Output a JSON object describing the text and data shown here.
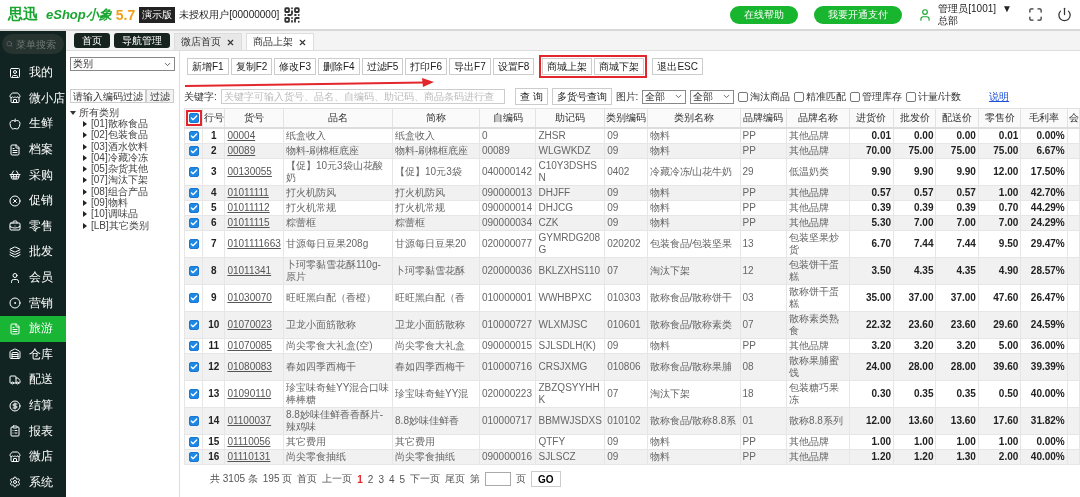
{
  "header": {
    "brand": "思迅",
    "product": "eShop小象",
    "version": "5.7",
    "edition": "演示版",
    "user_status": "未授权用户[00000000]",
    "buttons": [
      "在线帮助",
      "我要开通支付"
    ],
    "account": "管理员[1001]",
    "account_caret": "▼",
    "branch": "总部"
  },
  "nav": {
    "search_placeholder": "菜单搜索",
    "items": [
      {
        "label": "我的",
        "selected": false
      },
      {
        "label": "微小店",
        "selected": false
      },
      {
        "label": "生鲜",
        "selected": false
      },
      {
        "label": "档案",
        "selected": false
      },
      {
        "label": "采购",
        "selected": false
      },
      {
        "label": "促销",
        "selected": false
      },
      {
        "label": "零售",
        "selected": false
      },
      {
        "label": "批发",
        "selected": false
      },
      {
        "label": "会员",
        "selected": false
      },
      {
        "label": "营销",
        "selected": false
      },
      {
        "label": "旅游",
        "selected": true
      },
      {
        "label": "仓库",
        "selected": false
      },
      {
        "label": "配送",
        "selected": false
      },
      {
        "label": "结算",
        "selected": false
      },
      {
        "label": "报表",
        "selected": false
      },
      {
        "label": "微店",
        "selected": false
      },
      {
        "label": "系统",
        "selected": false
      }
    ]
  },
  "tabs": [
    {
      "label": "首页",
      "kind": "pinned",
      "selected": false
    },
    {
      "label": "导航管理",
      "kind": "pinned",
      "selected": false
    },
    {
      "label": "微店首页",
      "kind": "closable",
      "selected": false
    },
    {
      "label": "商品上架",
      "kind": "closable",
      "selected": true
    }
  ],
  "category_panel": {
    "type_select": "类别",
    "filter_placeholder": "请输入编码过滤",
    "filter_button": "过滤",
    "tree": [
      {
        "label": "所有类别",
        "expanded": true,
        "children": [
          {
            "label": "[01]散称食品",
            "expanded": false
          },
          {
            "label": "[02]包装食品",
            "expanded": false
          },
          {
            "label": "[03]酒水饮料",
            "expanded": false
          },
          {
            "label": "[04]冷藏冷冻",
            "expanded": false
          },
          {
            "label": "[05]杂货其他",
            "expanded": false
          },
          {
            "label": "[07]淘汰下架",
            "expanded": false
          },
          {
            "label": "[08]组合产品",
            "expanded": false
          },
          {
            "label": "[09]物料",
            "expanded": false
          },
          {
            "label": "[10]调味品",
            "expanded": false
          },
          {
            "label": "[LB]其它类别",
            "expanded": false
          }
        ]
      }
    ]
  },
  "toolbar": [
    {
      "highlighted": false,
      "buttons": [
        "新增F1",
        "复制F2",
        "修改F3",
        "删除F4",
        "过滤F5",
        "打印F6",
        "导出F7",
        "设置F8"
      ]
    },
    {
      "highlighted": true,
      "buttons": [
        "商城上架",
        "商城下架"
      ]
    },
    {
      "highlighted": false,
      "buttons": [
        "退出ESC"
      ]
    }
  ],
  "search": {
    "keyword_label": "关键字:",
    "keyword_placeholder": "关键字可输入货号、品名、自编码、助记码、商品条码进行查",
    "query_button": "查 询",
    "multi_button": "多货号查询",
    "picture_label": "图片:",
    "selects": [
      "全部",
      "全部"
    ],
    "options": [
      {
        "label": "淘汰商品",
        "checked": false
      },
      {
        "label": "精准匹配",
        "checked": false
      },
      {
        "label": "管理库存",
        "checked": false
      },
      {
        "label": "计量/计数",
        "checked": false
      }
    ],
    "help_link": "说明"
  },
  "table": {
    "select_all": {
      "checked": true,
      "highlighted": true
    },
    "columns": [
      {
        "label": "行号",
        "kind": "index"
      },
      {
        "label": "货号",
        "kind": "link"
      },
      {
        "label": "品名",
        "kind": "text"
      },
      {
        "label": "简称",
        "kind": "text"
      },
      {
        "label": "自编码",
        "kind": "text"
      },
      {
        "label": "助记码",
        "kind": "text"
      },
      {
        "label": "类别编码",
        "kind": "text"
      },
      {
        "label": "类别名称",
        "kind": "text"
      },
      {
        "label": "品牌编码",
        "kind": "text"
      },
      {
        "label": "品牌名称",
        "kind": "text"
      },
      {
        "label": "进货价",
        "kind": "number"
      },
      {
        "label": "批发价",
        "kind": "number"
      },
      {
        "label": "配送价",
        "kind": "number"
      },
      {
        "label": "零售价",
        "kind": "number"
      },
      {
        "label": "毛利率",
        "kind": "number"
      },
      {
        "label": "会",
        "kind": "text"
      }
    ],
    "rows": [
      {
        "checked": true,
        "cells": [
          "1",
          "00004",
          "纸盒收入",
          "纸盒收入",
          "0",
          "ZHSR",
          "09",
          "物料",
          "PP",
          "其他品牌",
          "0.01",
          "0.00",
          "0.00",
          "0.01",
          "0.00%"
        ]
      },
      {
        "checked": true,
        "cells": [
          "2",
          "00089",
          "物料-刷棉框底座",
          "物料-刷棉框底座",
          "00089",
          "WLGWKDZ",
          "09",
          "物料",
          "PP",
          "其他品牌",
          "70.00",
          "75.00",
          "75.00",
          "75.00",
          "6.67%"
        ]
      },
      {
        "checked": true,
        "cells": [
          "3",
          "00130055",
          "【促】10元3袋山花酸奶",
          "【促】10元3袋",
          "040000142",
          "C10Y3DSHSN",
          "0402",
          "冷藏冷冻/山花牛奶",
          "29",
          "低温奶类",
          "9.90",
          "9.90",
          "9.90",
          "12.00",
          "17.50%"
        ]
      },
      {
        "checked": true,
        "cells": [
          "4",
          "01011111",
          "打火机防风",
          "打火机防风",
          "090000013",
          "DHJFF",
          "09",
          "物料",
          "PP",
          "其他品牌",
          "0.57",
          "0.57",
          "0.57",
          "1.00",
          "42.70%"
        ]
      },
      {
        "checked": true,
        "cells": [
          "5",
          "01011112",
          "打火机常规",
          "打火机常规",
          "090000014",
          "DHJCG",
          "09",
          "物料",
          "PP",
          "其他品牌",
          "0.39",
          "0.39",
          "0.39",
          "0.70",
          "44.29%"
        ]
      },
      {
        "checked": true,
        "cells": [
          "6",
          "01011115",
          "粽蕾框",
          "粽蕾框",
          "090000034",
          "CZK",
          "09",
          "物料",
          "PP",
          "其他品牌",
          "5.30",
          "7.00",
          "7.00",
          "7.00",
          "24.29%"
        ]
      },
      {
        "checked": true,
        "cells": [
          "7",
          "0101111663",
          "甘源每日豆果208g",
          "甘源每日豆果20",
          "020000077",
          "GYMRDG208G",
          "020202",
          "包装食品/包装坚果",
          "13",
          "包装坚果炒货",
          "6.70",
          "7.44",
          "7.44",
          "9.50",
          "29.47%"
        ]
      },
      {
        "checked": true,
        "cells": [
          "8",
          "01011341",
          "卜珂零黏雪花酥110g-原片",
          "卜珂零黏雪花酥",
          "020000036",
          "BKLZXHS110",
          "07",
          "淘汰下架",
          "12",
          "包装饼干蛋糕",
          "3.50",
          "4.35",
          "4.35",
          "4.90",
          "28.57%"
        ]
      },
      {
        "checked": true,
        "cells": [
          "9",
          "01030070",
          "旺旺黑白配（香橙）",
          "旺旺黑白配（香",
          "010000001",
          "WWHBPXC",
          "010303",
          "散称食品/散称饼干",
          "03",
          "散称饼干蛋糕",
          "35.00",
          "37.00",
          "37.00",
          "47.60",
          "26.47%"
        ]
      },
      {
        "checked": true,
        "cells": [
          "10",
          "01070023",
          "卫龙小面筋散称",
          "卫龙小面筋散称",
          "010000727",
          "WLXMJSC",
          "010601",
          "散称食品/散称素类",
          "07",
          "散称素类熟食",
          "22.32",
          "23.60",
          "23.60",
          "29.60",
          "24.59%"
        ]
      },
      {
        "checked": true,
        "cells": [
          "11",
          "01070085",
          "尚尖零食大礼盒(空)",
          "尚尖零食大礼盒",
          "090000015",
          "SJLSDLH(K)",
          "09",
          "物料",
          "PP",
          "其他品牌",
          "3.20",
          "3.20",
          "3.20",
          "5.00",
          "36.00%"
        ]
      },
      {
        "checked": true,
        "cells": [
          "12",
          "01080083",
          "春如四季西梅干",
          "春如四季西梅干",
          "010000716",
          "CRSJXMG",
          "010806",
          "散称食品/散称果脯",
          "08",
          "散称果脯蜜饯",
          "24.00",
          "28.00",
          "28.00",
          "39.60",
          "39.39%"
        ]
      },
      {
        "checked": true,
        "cells": [
          "13",
          "01090110",
          "珍宝味奇鲑YY混合口味棒棒糖",
          "珍宝味奇鲑YY混",
          "020000223",
          "ZBZQSYYHHK",
          "07",
          "淘汰下架",
          "18",
          "包装糖巧果冻",
          "0.30",
          "0.35",
          "0.35",
          "0.50",
          "40.00%"
        ]
      },
      {
        "checked": true,
        "cells": [
          "14",
          "01100037",
          "8.8妙味佳鲜香香酥片-辣鸡味",
          "8.8妙味佳鲜香",
          "010000717",
          "BBMWJSDXS",
          "010102",
          "散称食品/散称8.8系",
          "01",
          "散称8.8系列",
          "12.00",
          "13.60",
          "13.60",
          "17.60",
          "31.82%"
        ]
      },
      {
        "checked": true,
        "cells": [
          "15",
          "01110056",
          "其它费用",
          "其它费用",
          null,
          "QTFY",
          "09",
          "物料",
          "PP",
          "其他品牌",
          "1.00",
          "1.00",
          "1.00",
          "1.00",
          "0.00%"
        ]
      },
      {
        "checked": true,
        "cells": [
          "16",
          "01110131",
          "尚尖零食抽纸",
          "尚尖零食抽纸",
          "090000016",
          "SJLSCZ",
          "09",
          "物料",
          "PP",
          "其他品牌",
          "1.20",
          "1.20",
          "1.30",
          "2.00",
          "40.00%"
        ]
      }
    ]
  },
  "pagination": {
    "total": "共 3105 条",
    "pages": "195 页",
    "first": "首页",
    "prev": "上一页",
    "page_numbers": [
      {
        "label": "1",
        "selected": true
      },
      {
        "label": "2",
        "selected": false
      },
      {
        "label": "3",
        "selected": false
      },
      {
        "label": "4",
        "selected": false
      },
      {
        "label": "5",
        "selected": false
      }
    ],
    "next": "下一页",
    "last": "尾页",
    "goto_prefix": "第",
    "goto_suffix": "页",
    "go_button": "GO"
  }
}
